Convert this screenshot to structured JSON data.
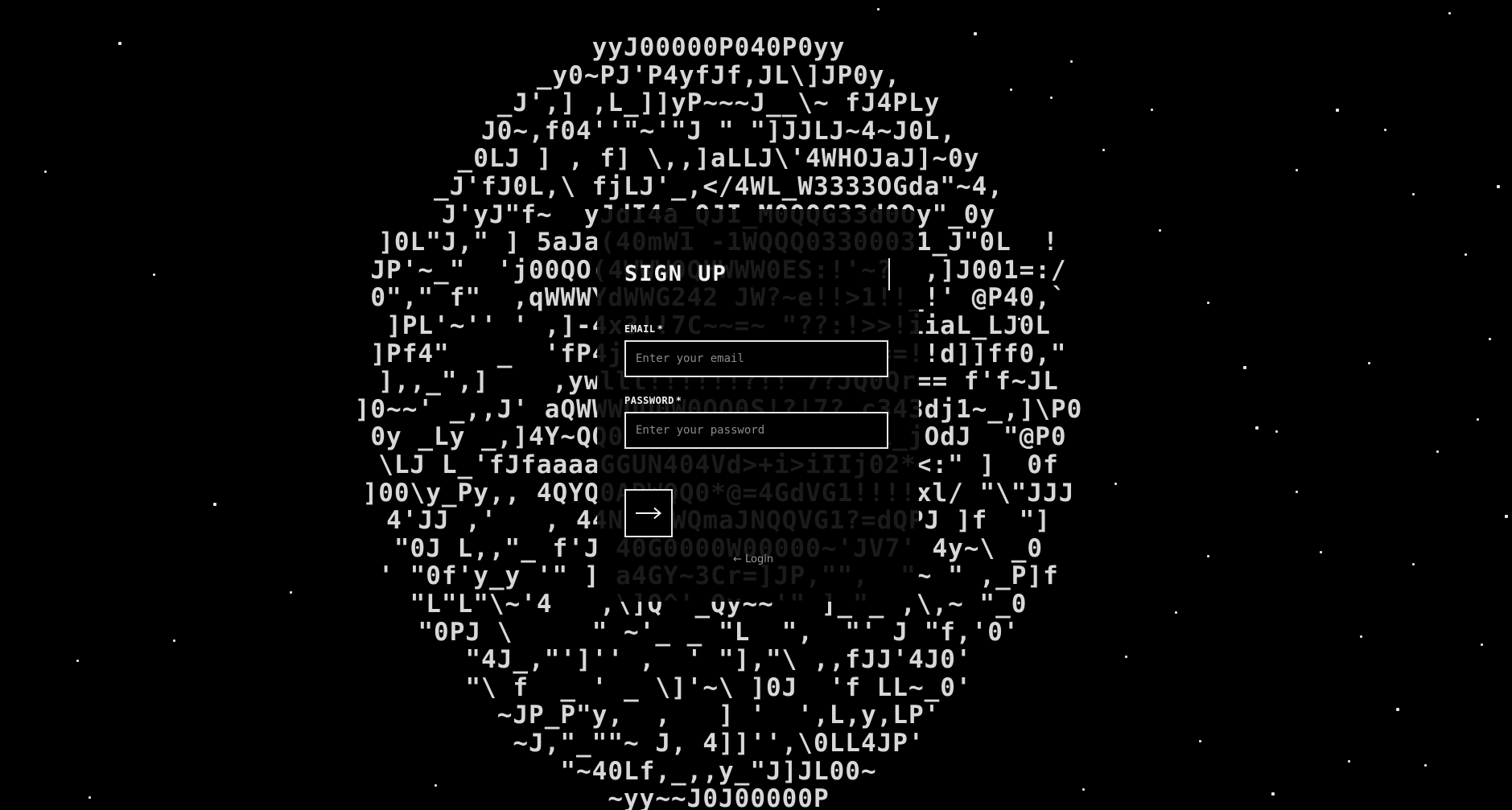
{
  "background": {
    "ascii_art": [
      "yyJ00000P040P0yy",
      "_y0~PJ'P4yfJf,JL\\]JP0y,",
      "_J',] ,L_]]yP~~~J__\\~ fJ4PLy",
      "J0~,f04''\"~'\"J \" \"]JJLJ~4~J0L,",
      "_0LJ ] , f] \\,,]aLLJ\\'4WHOJaJ]~0y",
      "_J'fJ0L,\\ fjLJ'_,</4WL_W3333OGda\"~4,",
      "J'yJ\"f~  yJdI4a_QJI_M0QQG33d0Oy\"_0y",
      "]0L\"J,\" ] 5aJa(40mW1 -1WQQQ03300031_J\"0L  !",
      "JP'~_\"  'j00QO(4WWW0QHWWW0ES:!'~?  ,]J001=:/",
      "0\",\" f\"  ,qWWWYdWWG242 JW?~e!!>1!!_!' @P40,`",
      "]PL'~'' ' ,]-4x3!!7C~~=~ \"??:!>>!iiaL_LJ0L",
      "]Pf4\"   _  'fP4jl!!!!!!!!!\",\"~'~==!!d]]ff0,\"",
      "],,_\",]    ,ywlll!!!!!!?!!^7?JQ0Qr== f'f~JL",
      "]0~~' _,,J' aQWWWQO0W0QQ0S!?!7?,c343dj1~_,]\\P0",
      "0y _Ly _,]4Y~QQ00V0D00WWJV1!>!!!i_jOdJ  \"@P0",
      "\\LJ L_'fJfaaaaGGUN404Vd>+i>iIIj02*<:\" ]  0f",
      "]00\\y_Py,, 4QYQ0ADWQQ0*@=4GdVG1!!!!xl/ \"\\\"JJJ",
      "4'JJ ,'   , 44N0WWWQmaJNQQVG1?=dQPJ ]f  \"]",
      "\"0J L,,\"_ f'J 40G0000W00000~'JV7' 4y~\\ _0",
      "' \"0f'y_y '\" ] a4GY~3Cr=]JP,\"\",  \"~ \" ,_P]f",
      "\"L\"L\"\\~'4   ,\\]Q^'_Qy~~'\" ]_\"_ ,\\,~ \"_0",
      "\"0PJ \\     \" ~'_ _ \"L  \",  \"' J \"f,'0'",
      "\"4J_,\"']'' ,  ' \"],\"\\ ,,fJJ'4J0'",
      "\"\\ f  _ ' _ \\]'~\\ ]0J  'f LL~_0'",
      "~JP_P\"y,  ,   ] '  ',L,y,LP'",
      "~J,\"_\"\"~ J, 4]]'',\\0LL4JP'",
      "\"~40Lf,_,,y_\"J]JL00~",
      "~yy~~J0J00000P"
    ]
  },
  "form": {
    "title": "Sign Up",
    "email": {
      "label": "EMAIL",
      "required_mark": "*",
      "placeholder": "Enter your email",
      "value": ""
    },
    "password": {
      "label": "PASSWORD",
      "required_mark": "*",
      "placeholder": "Enter your password",
      "value": ""
    },
    "submit_icon": "arrow-right-icon",
    "login_link": "← Login"
  },
  "colors": {
    "background": "#000000",
    "foreground": "#f4f4f4",
    "placeholder": "#8a8a8a",
    "link": "#9a9a9a"
  }
}
